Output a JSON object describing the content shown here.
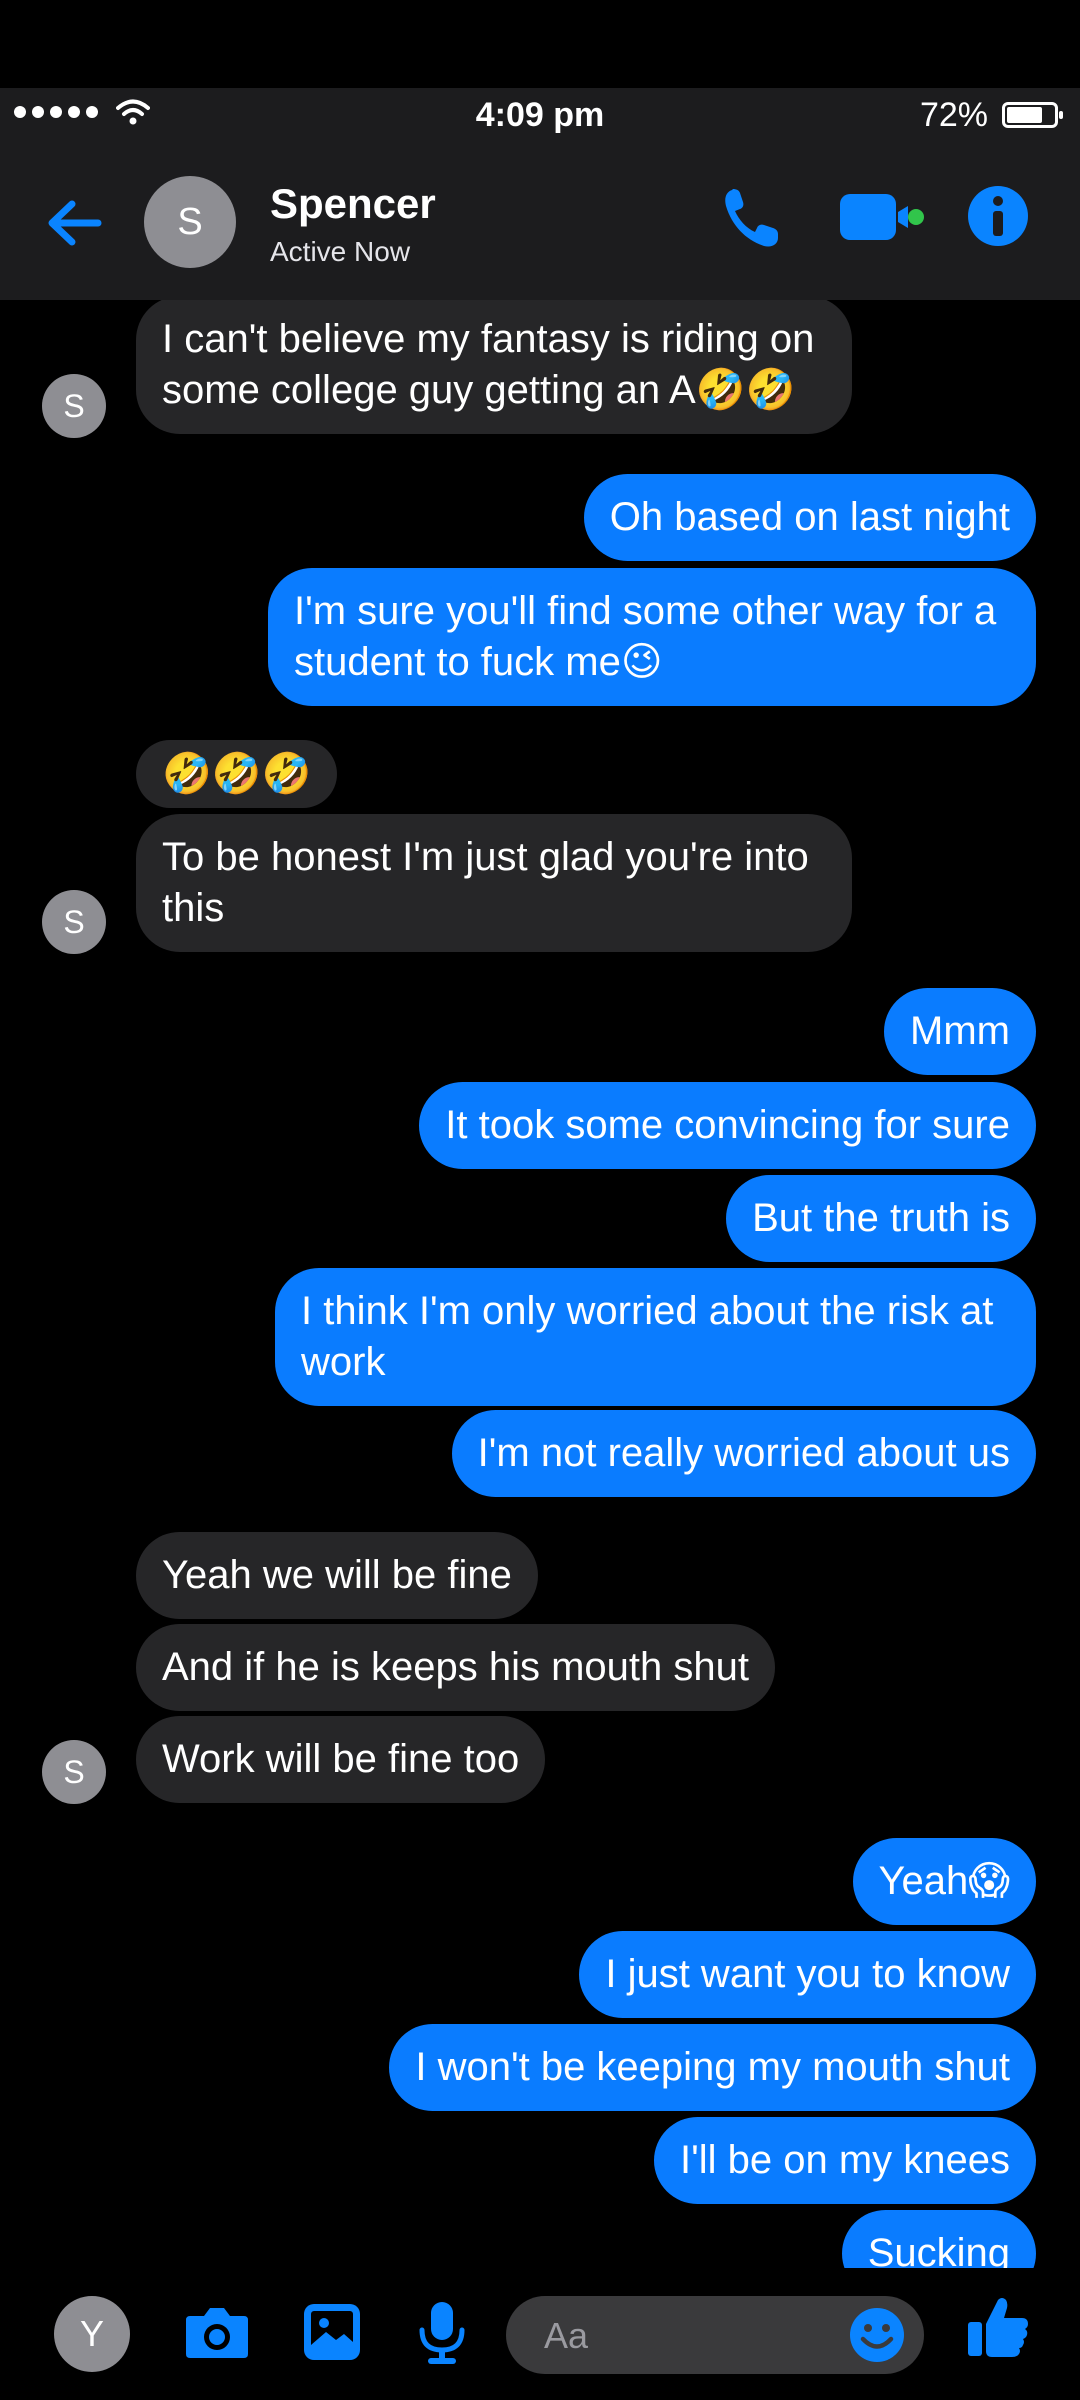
{
  "status_bar": {
    "time": "4:09 pm",
    "battery_percent": "72%",
    "battery_level": 0.72
  },
  "header": {
    "avatar_initial": "S",
    "name": "Spencer",
    "status": "Active Now"
  },
  "colors": {
    "accent": "#0a7cff",
    "incoming_bubble": "#262628",
    "header_bg": "#1c1c1e",
    "background": "#000000"
  },
  "messages": [
    {
      "from": "them",
      "text": "I can't believe my fantasy is riding on some college guy getting an A🤣🤣"
    },
    {
      "from": "me",
      "text": "Oh based on last night"
    },
    {
      "from": "me",
      "text": "I'm sure you'll find some other way for a student to fuck me😉"
    },
    {
      "from": "them",
      "text": "🤣🤣🤣"
    },
    {
      "from": "them",
      "text": "To be honest I'm just glad you're into this"
    },
    {
      "from": "me",
      "text": "Mmm"
    },
    {
      "from": "me",
      "text": "It took some convincing for sure"
    },
    {
      "from": "me",
      "text": "But the truth is"
    },
    {
      "from": "me",
      "text": "I think I'm only worried about the risk at work"
    },
    {
      "from": "me",
      "text": "I'm not really worried about us"
    },
    {
      "from": "them",
      "text": "Yeah we will be fine"
    },
    {
      "from": "them",
      "text": "And if he is keeps his mouth shut"
    },
    {
      "from": "them",
      "text": "Work will be fine too"
    },
    {
      "from": "me",
      "text": "Yeah😱"
    },
    {
      "from": "me",
      "text": "I just want you to know"
    },
    {
      "from": "me",
      "text": "I won't be keeping my mouth shut"
    },
    {
      "from": "me",
      "text": "I'll be on my knees"
    },
    {
      "from": "me",
      "text": "Sucking"
    }
  ],
  "sender_avatar_initial": "S",
  "composer": {
    "user_initial": "Y",
    "placeholder": "Aa"
  },
  "icons": [
    "back-arrow-icon",
    "phone-icon",
    "video-camera-icon",
    "info-icon",
    "camera-icon",
    "photo-icon",
    "microphone-icon",
    "smiley-icon",
    "thumbs-up-icon"
  ]
}
